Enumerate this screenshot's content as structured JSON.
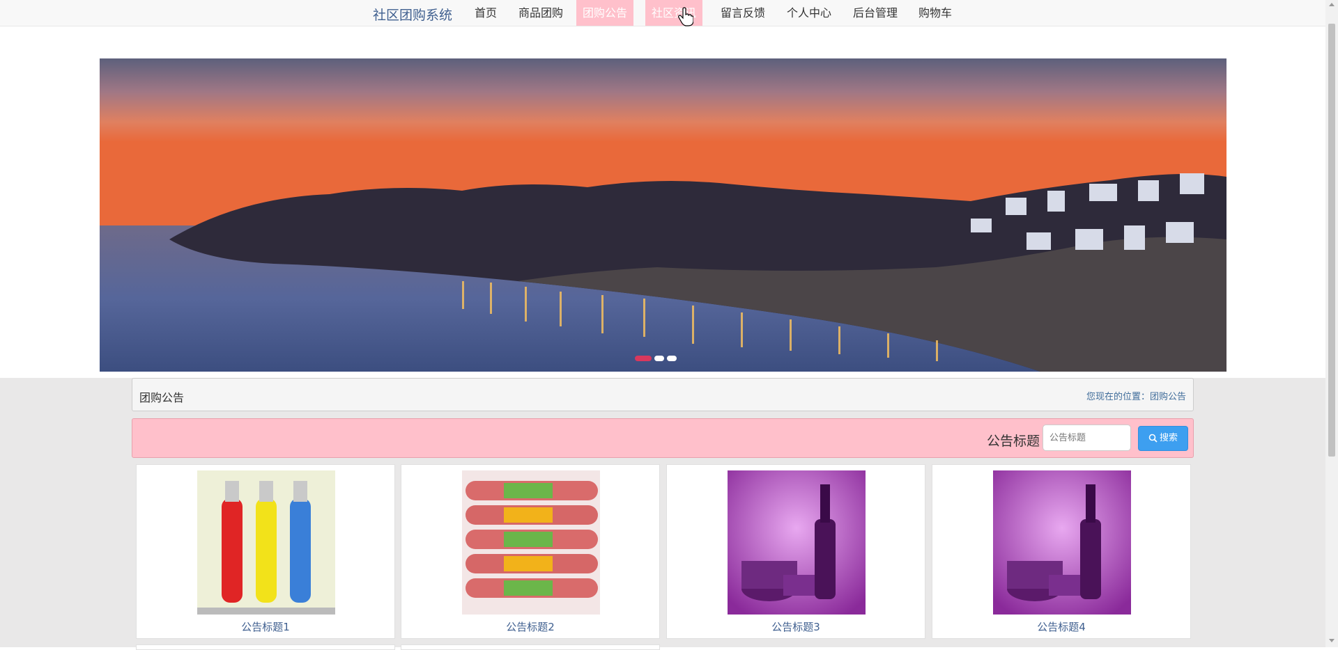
{
  "nav": {
    "brand": "社区团购系统",
    "items": [
      {
        "label": "首页",
        "highlight": false
      },
      {
        "label": "商品团购",
        "highlight": false
      },
      {
        "label": "团购公告",
        "highlight": true
      },
      {
        "label": "社区资讯",
        "highlight": true
      },
      {
        "label": "留言反馈",
        "highlight": false
      },
      {
        "label": "个人中心",
        "highlight": false
      },
      {
        "label": "后台管理",
        "highlight": false
      },
      {
        "label": "购物车",
        "highlight": false
      }
    ]
  },
  "banner": {
    "slide_count": 3,
    "active_slide": 1
  },
  "breadcrumb": {
    "title": "团购公告",
    "location_prefix": "您现在的位置：",
    "location": "团购公告"
  },
  "search": {
    "label": "公告标题",
    "placeholder": "公告标题",
    "button_label": "搜索"
  },
  "cards": [
    {
      "title": "公告标题1"
    },
    {
      "title": "公告标题2"
    },
    {
      "title": "公告标题3"
    },
    {
      "title": "公告标题4"
    }
  ],
  "colors": {
    "accent_pink": "#ffc0cb",
    "brand_blue": "#3f5f8f",
    "button_blue": "#3d9ff0",
    "carousel_active": "#d9385d"
  }
}
